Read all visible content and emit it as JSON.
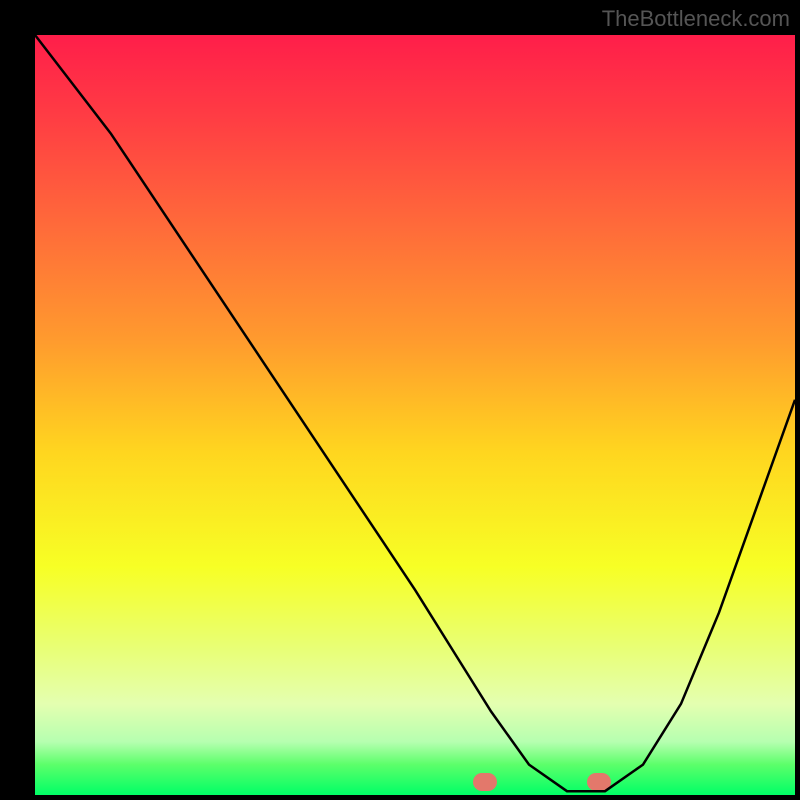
{
  "watermark": "TheBottleneck.com",
  "chart_data": {
    "type": "line",
    "title": "",
    "xlabel": "",
    "ylabel": "",
    "xlim": [
      0,
      100
    ],
    "ylim": [
      0,
      100
    ],
    "grid": false,
    "legend": false,
    "series": [
      {
        "name": "curve",
        "x": [
          0,
          10,
          20,
          30,
          40,
          50,
          55,
          60,
          65,
          70,
          75,
          80,
          85,
          90,
          95,
          100
        ],
        "y": [
          100,
          87,
          72,
          57,
          42,
          27,
          19,
          11,
          4,
          0.5,
          0.5,
          4,
          12,
          24,
          38,
          52
        ]
      }
    ],
    "floor_markers": [
      {
        "x": 60,
        "label": "optimal-start"
      },
      {
        "x": 75,
        "label": "optimal-end"
      }
    ],
    "background_gradient": {
      "top": "#ff1e4a",
      "mid": "#ffd61f",
      "bottom": "#00ff66"
    }
  }
}
